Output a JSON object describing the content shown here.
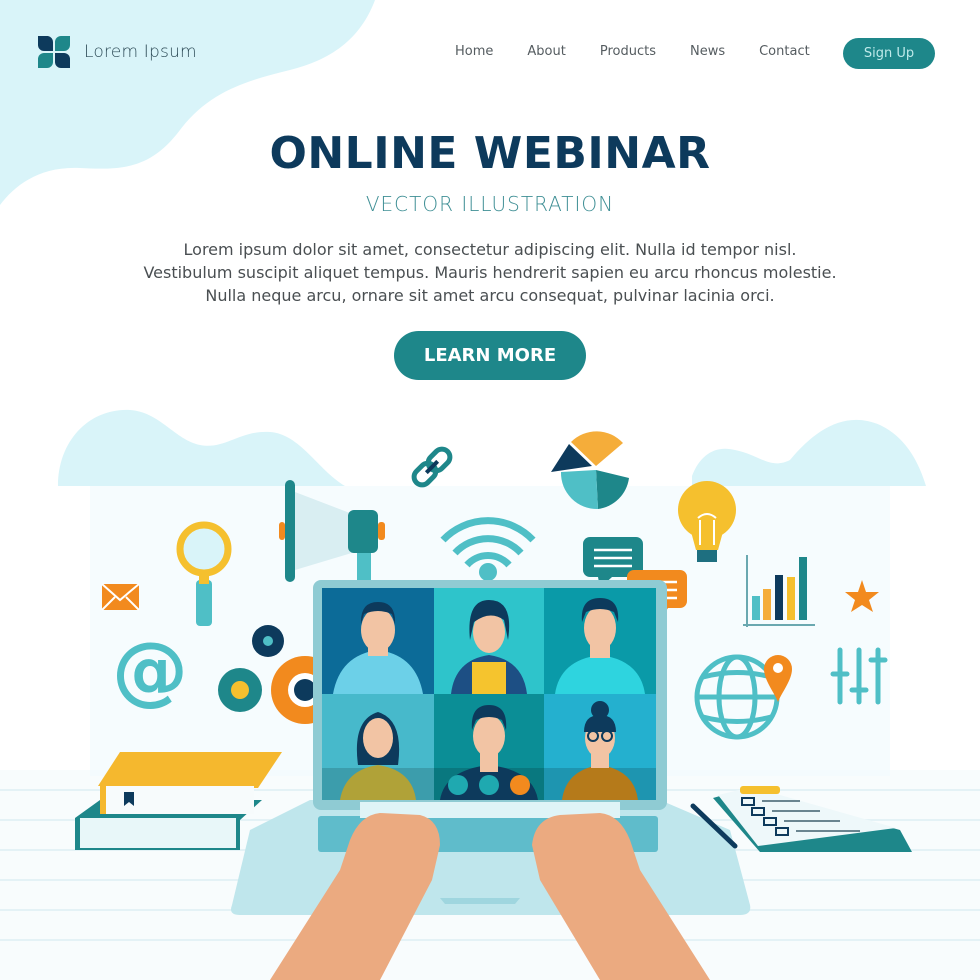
{
  "brand": {
    "name": "Lorem Ipsum",
    "logo_icon": "four-petal-logo-icon"
  },
  "nav": {
    "items": [
      {
        "label": "Home"
      },
      {
        "label": "About"
      },
      {
        "label": "Products"
      },
      {
        "label": "News"
      },
      {
        "label": "Contact"
      }
    ],
    "signup_label": "Sign Up"
  },
  "hero": {
    "title": "ONLINE WEBINAR",
    "subtitle": "VECTOR  ILLUSTRATION",
    "description_lines": [
      "Lorem ipsum dolor sit amet, consectetur adipiscing elit. Nulla id tempor nisl.",
      "Vestibulum suscipit aliquet tempus. Mauris hendrerit sapien eu arcu rhoncus molestie.",
      "Nulla neque arcu, ornare sit amet arcu consequat, pulvinar lacinia orci."
    ],
    "cta_label": "LEARN MORE"
  },
  "illustration": {
    "icons": [
      "envelope-icon",
      "magnifier-icon",
      "megaphone-icon",
      "link-icon",
      "wifi-icon",
      "pie-chart-icon",
      "lightbulb-icon",
      "bar-chart-icon",
      "star-icon",
      "at-sign-icon",
      "gears-icon",
      "globe-pin-icon",
      "sliders-icon",
      "chat-bubble-icon",
      "books-icon",
      "clipboard-checklist-icon",
      "pen-icon"
    ],
    "video_call": {
      "participants": 6,
      "controls": [
        "microphone-icon",
        "camera-icon",
        "end-call-icon"
      ]
    }
  },
  "colors": {
    "navy": "#0d3a5c",
    "teal": "#1e878a",
    "light_teal": "#4fbfc6",
    "orange": "#f28a1e",
    "yellow": "#f5c02e",
    "pale_blue": "#d8f3f8",
    "skin": "#f2c4a4"
  }
}
